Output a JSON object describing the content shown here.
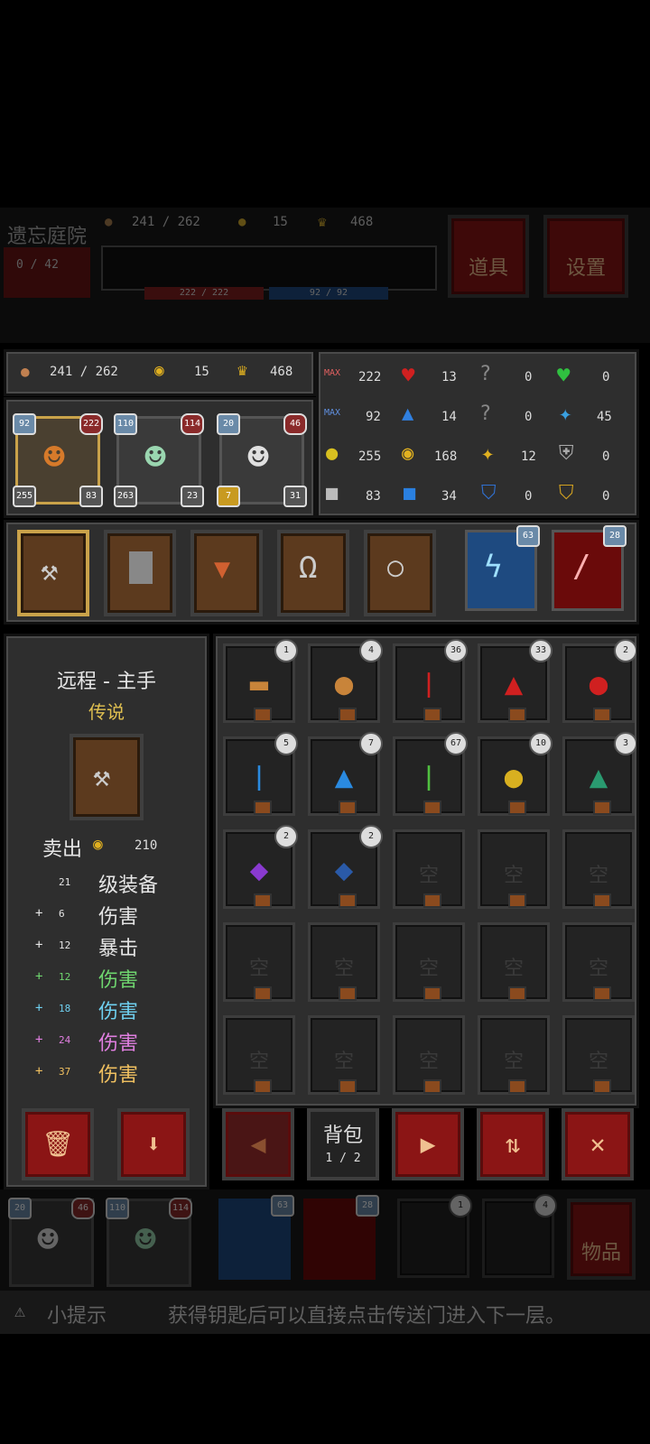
{
  "top": {
    "location": "遗忘庭院",
    "floor": "0 / 42",
    "food": "241 / 262",
    "gold": "15",
    "crown": "468",
    "hp_bar": "222 / 222",
    "mp_bar": "92 / 92",
    "items_btn": "道具",
    "settings_btn": "设置"
  },
  "resources": {
    "food": "241 / 262",
    "gold": "15",
    "crown": "468"
  },
  "heroes": [
    {
      "level": "92",
      "hp": "222",
      "atk": "255",
      "def": "83"
    },
    {
      "level": "110",
      "hp": "114",
      "atk": "263",
      "def": "23"
    },
    {
      "level": "20",
      "hp": "46",
      "atk": "7",
      "def": "31"
    }
  ],
  "stats": [
    [
      "222",
      "13",
      "0",
      "0"
    ],
    [
      "92",
      "14",
      "0",
      "45"
    ],
    [
      "255",
      "168",
      "12",
      "0"
    ],
    [
      "83",
      "34",
      "0",
      "0"
    ]
  ],
  "stat_max": "MAX",
  "skills": [
    {
      "level": "63"
    },
    {
      "level": "28"
    }
  ],
  "detail": {
    "title": "远程 - 主手",
    "rarity": "传说",
    "sell_label": "卖出",
    "sell_price": "210",
    "lines": [
      {
        "prefix": "",
        "value": "21",
        "label": "级装备",
        "color": "#e6e6e6"
      },
      {
        "prefix": "+",
        "value": "6",
        "label": "伤害",
        "color": "#e6e6e6"
      },
      {
        "prefix": "+",
        "value": "12",
        "label": "暴击",
        "color": "#e6e6e6"
      },
      {
        "prefix": "+",
        "value": "12",
        "label": "伤害",
        "color": "#6fd66f"
      },
      {
        "prefix": "+",
        "value": "18",
        "label": "伤害",
        "color": "#6fd0f0"
      },
      {
        "prefix": "+",
        "value": "24",
        "label": "伤害",
        "color": "#e07fe0"
      },
      {
        "prefix": "+",
        "value": "37",
        "label": "伤害",
        "color": "#f0c060"
      }
    ]
  },
  "inventory": {
    "empty_label": "空",
    "items": [
      {
        "name": "bread",
        "count": "1"
      },
      {
        "name": "meat",
        "count": "4"
      },
      {
        "name": "red-tube",
        "count": "36"
      },
      {
        "name": "red-flask",
        "count": "33"
      },
      {
        "name": "red-big-flask",
        "count": "2"
      },
      {
        "name": "blue-tube",
        "count": "5"
      },
      {
        "name": "blue-flask",
        "count": "7"
      },
      {
        "name": "green-tube",
        "count": "67"
      },
      {
        "name": "yellow-flask",
        "count": "10"
      },
      {
        "name": "teal-flask",
        "count": "3"
      },
      {
        "name": "purple-gem",
        "count": "2"
      },
      {
        "name": "blue-gem",
        "count": "2"
      }
    ],
    "bag_label": "背包",
    "bag_page": "1 / 2"
  },
  "bottom": {
    "hero_a": {
      "level": "20",
      "hp": "46",
      "atk": "7",
      "def": "31"
    },
    "hero_b": {
      "level": "110",
      "hp": "114",
      "atk": "263",
      "def": "23"
    },
    "skill_a": "63",
    "skill_b": "28",
    "item_a": "1",
    "item_b": "4",
    "items_btn": "物品"
  },
  "tip": {
    "label": "小提示",
    "text": "获得钥匙后可以直接点击传送门进入下一层。"
  }
}
